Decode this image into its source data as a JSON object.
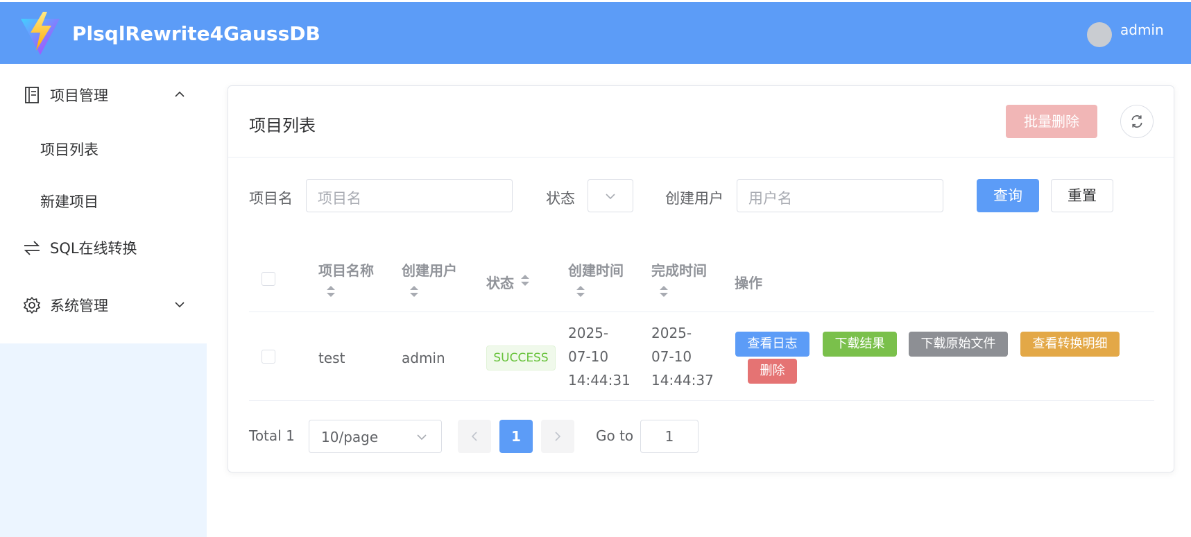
{
  "header": {
    "app_title": "PlsqlRewrite4GaussDB",
    "username": "admin",
    "logo_icon": "vite-bolt-logo"
  },
  "sidebar": {
    "menus": [
      {
        "label": "项目管理",
        "icon": "document-icon",
        "expanded": true,
        "children": [
          {
            "label": "项目列表"
          },
          {
            "label": "新建项目"
          }
        ]
      },
      {
        "label": "SQL在线转换",
        "icon": "swap-icon"
      },
      {
        "label": "系统管理",
        "icon": "gear-icon",
        "expanded": false
      }
    ]
  },
  "card": {
    "title": "项目列表",
    "batch_delete_label": "批量删除",
    "filters": {
      "project_label": "项目名",
      "project_placeholder": "项目名",
      "status_label": "状态",
      "user_label": "创建用户",
      "user_placeholder": "用户名",
      "query_label": "查询",
      "reset_label": "重置"
    },
    "table": {
      "headers": [
        "项目名称",
        "创建用户",
        "状态",
        "创建时间",
        "完成时间",
        "操作"
      ],
      "rows": [
        {
          "name": "test",
          "user": "admin",
          "status": "SUCCESS",
          "created": [
            "2025-",
            "07-10",
            "14:44:31"
          ],
          "finished": [
            "2025-",
            "07-10",
            "14:44:37"
          ],
          "actions": [
            "查看日志",
            "下载结果",
            "下载原始文件",
            "查看转换明细",
            "删除"
          ]
        }
      ]
    },
    "pagination": {
      "total_text": "Total 1",
      "page_size": "10/page",
      "current_page": "1",
      "goto_label": "Go to",
      "goto_value": "1"
    }
  },
  "colors": {
    "primary": "#5c9cf7",
    "success": "#7ac04b",
    "info": "#8d8f94",
    "warning": "#e3a847",
    "danger": "#e57373",
    "danger_light": "#f1b6b6"
  }
}
